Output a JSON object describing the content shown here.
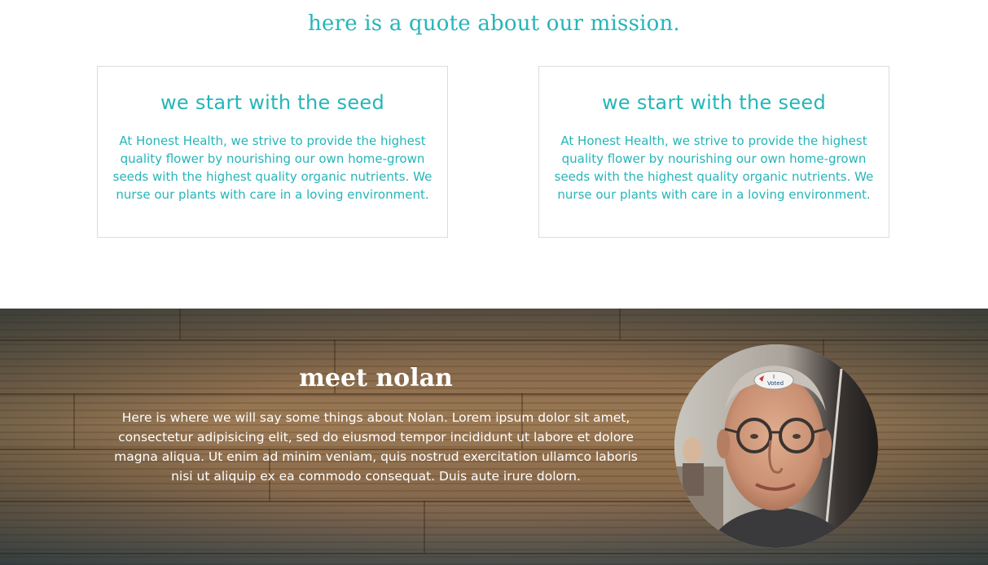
{
  "colors": {
    "accent": "#26b5b8",
    "about_text": "#ffffff",
    "card_border": "#dcdcdc"
  },
  "mission": {
    "quote": "here is a quote about our mission."
  },
  "cards": [
    {
      "title": "we start with the seed",
      "body": "At Honest Health, we strive to provide the highest quality flower by nourishing our own home-grown seeds with the highest quality organic nutrients. We nurse our plants with care in a loving environment."
    },
    {
      "title": "we start with the seed",
      "body": "At Honest Health, we strive to provide the highest quality flower by nourishing our own home-grown seeds with the highest quality organic nutrients. We nurse our plants with care in a loving environment."
    }
  ],
  "about": {
    "title": "meet nolan",
    "body": "Here is where we will say some things about Nolan. Lorem ipsum dolor sit amet, consectetur adipisicing elit, sed do eiusmod tempor incididunt ut labore et dolore magna aliqua. Ut enim ad minim veniam, quis nostrud exercitation ullamco laboris nisi ut aliquip ex ea commodo consequat. Duis aute irure dolorn.",
    "photo_sticker_text": "I Voted"
  }
}
